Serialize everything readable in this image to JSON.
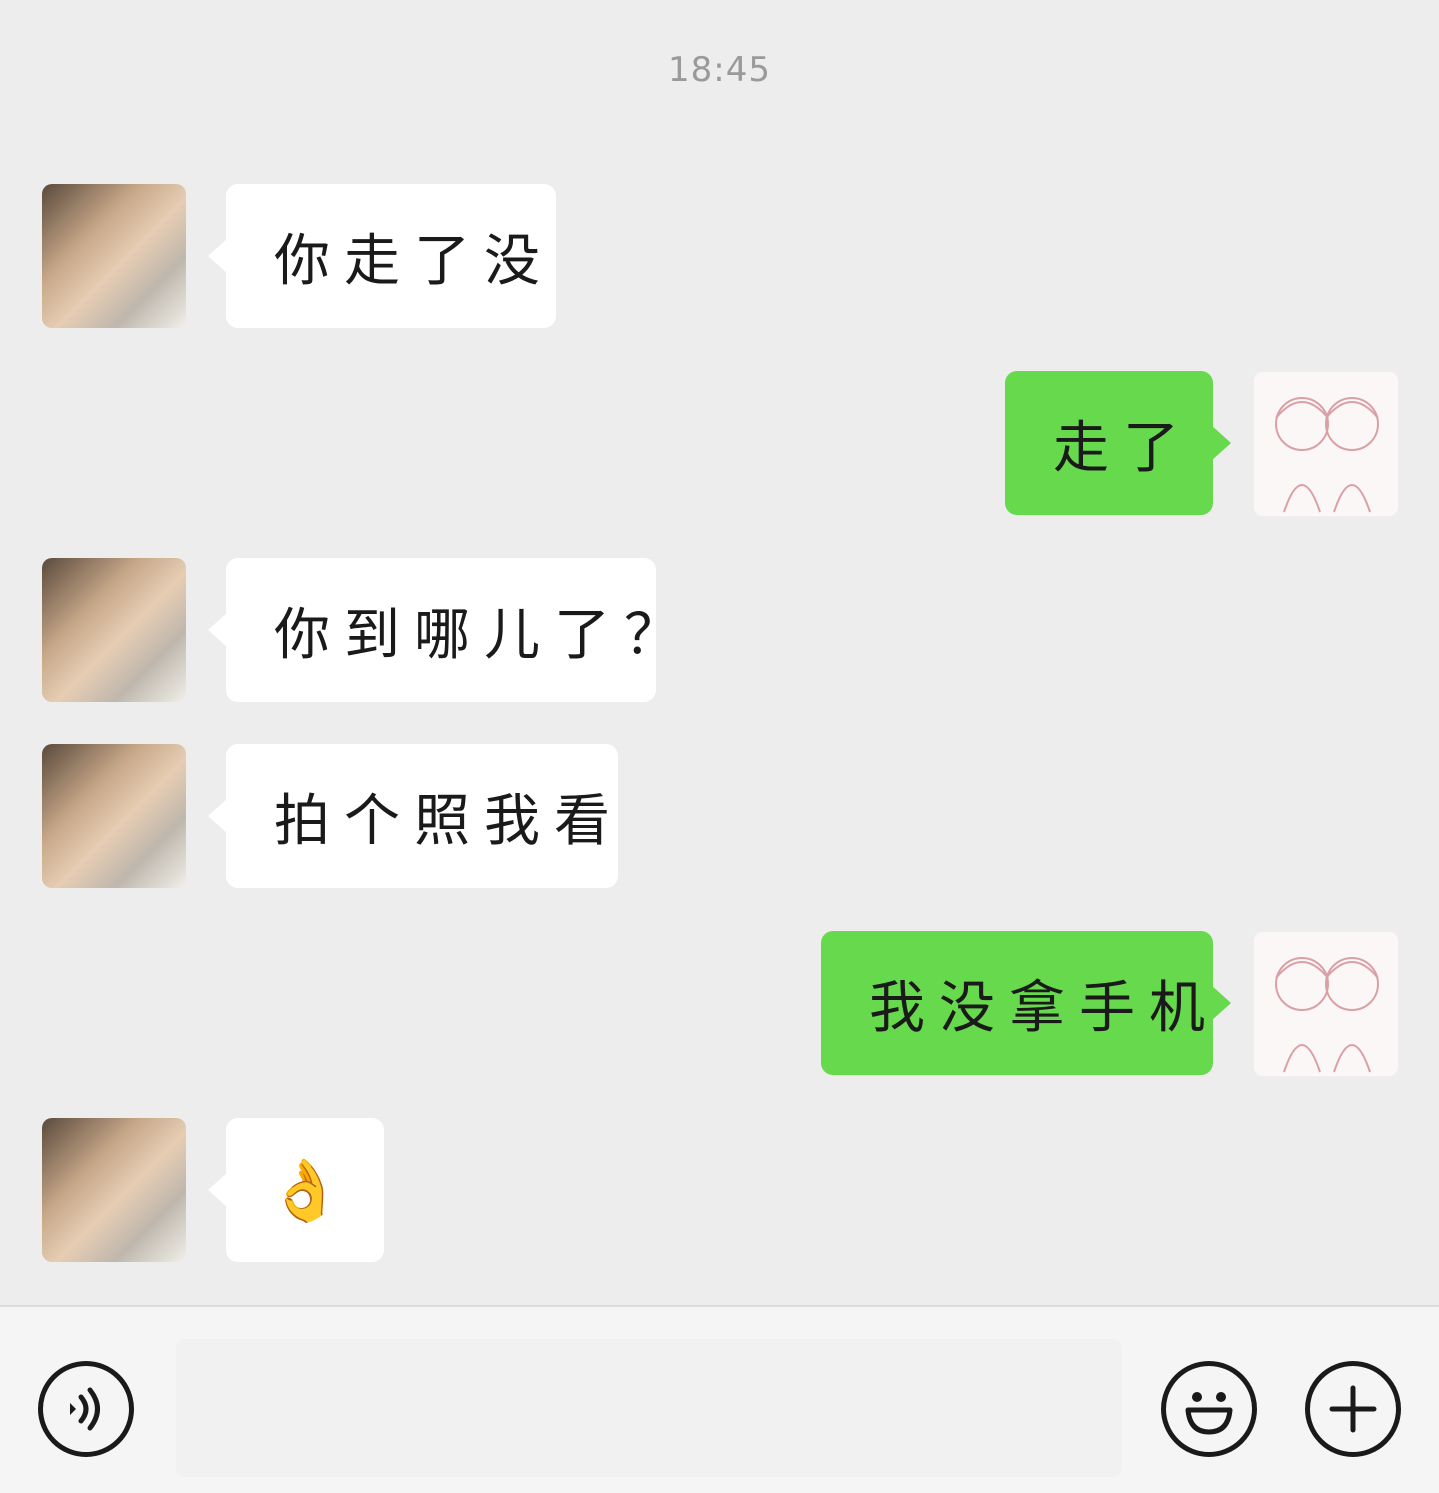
{
  "timestamp": "18:45",
  "messages": [
    {
      "side": "in",
      "text": "你走了没"
    },
    {
      "side": "out",
      "text": "走了"
    },
    {
      "side": "in",
      "text": "你到哪儿了？"
    },
    {
      "side": "in",
      "text": "拍个照我看"
    },
    {
      "side": "out",
      "text": "我没拿手机"
    },
    {
      "side": "in",
      "text": "👌"
    }
  ],
  "input_bar": {
    "voice_icon": "voice-icon",
    "emoji_icon": "smiley-icon",
    "plus_icon": "plus-icon"
  },
  "colors": {
    "background": "#ededed",
    "outgoing_bubble": "#66d94c",
    "incoming_bubble": "#ffffff"
  }
}
